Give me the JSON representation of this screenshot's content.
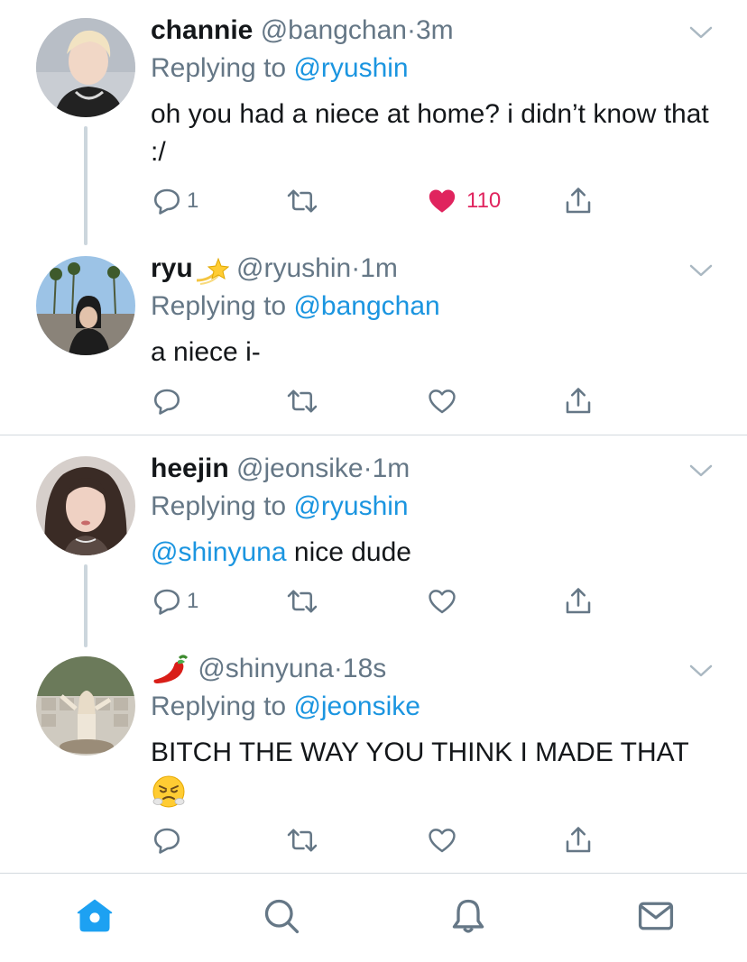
{
  "tweets": [
    {
      "name": "channie",
      "handle": "@bangchan",
      "time": "3m",
      "replying_label": "Replying to",
      "replying_to": "@ryushin",
      "text": "oh you had a niece at home? i didn’t know that :/",
      "replies": "1",
      "likes": "110",
      "liked": true
    },
    {
      "name": "ryu",
      "name_emoji": "dizzy-icon",
      "handle": "@ryushin",
      "time": "1m",
      "replying_label": "Replying to",
      "replying_to": "@bangchan",
      "text": "a niece i-"
    },
    {
      "name": "heejin",
      "handle": "@jeonsike",
      "time": "1m",
      "replying_label": "Replying to",
      "replying_to": "@ryushin",
      "mention": "@shinyuna",
      "text": " nice dude",
      "replies": "1"
    },
    {
      "name_emoji": "hot-pepper-icon",
      "handle": "@shinyuna",
      "time": "18s",
      "replying_label": "Replying to",
      "replying_to": "@jeonsike",
      "text": "BITCH THE WAY YOU THINK I MADE THAT",
      "text_emoji": "face-with-steam-icon"
    }
  ],
  "separator": "·",
  "tabs": [
    "home-icon",
    "search-icon",
    "bell-icon",
    "mail-icon"
  ],
  "colors": {
    "link": "#1b95e0",
    "like": "#e0245e",
    "muted": "#657786",
    "active_tab": "#1da1f2"
  }
}
